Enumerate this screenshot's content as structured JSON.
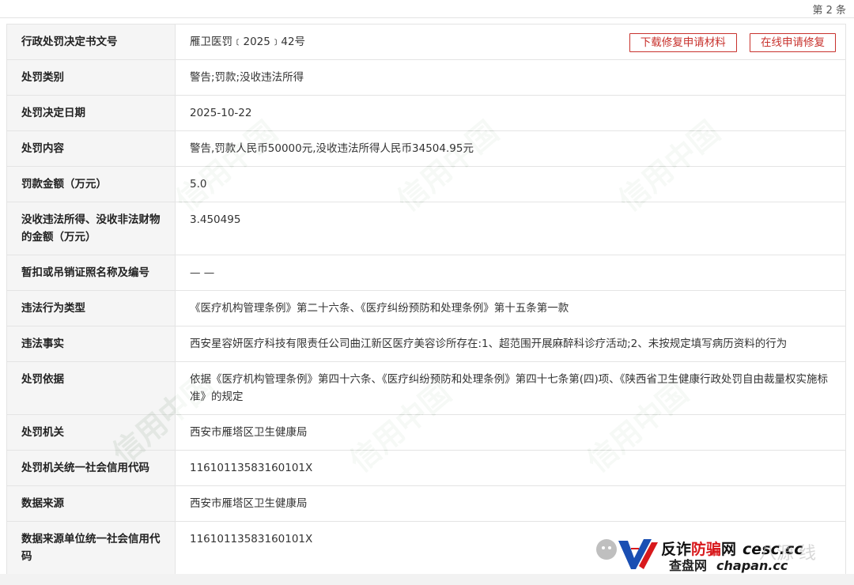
{
  "header": {
    "record_number": "第 2 条"
  },
  "actions": {
    "download_label": "下载修复申请材料",
    "online_label": "在线申请修复"
  },
  "rows": [
    {
      "key": "行政处罚决定书文号",
      "value": "雁卫医罚﹝2025﹞42号"
    },
    {
      "key": "处罚类别",
      "value": "警告;罚款;没收违法所得"
    },
    {
      "key": "处罚决定日期",
      "value": "2025-10-22"
    },
    {
      "key": "处罚内容",
      "value": "警告,罚款人民币50000元,没收违法所得人民币34504.95元"
    },
    {
      "key": "罚款金额（万元）",
      "value": "5.0"
    },
    {
      "key": "没收违法所得、没收非法财物的金额（万元）",
      "value": "3.450495"
    },
    {
      "key": "暂扣或吊销证照名称及编号",
      "value": "— —"
    },
    {
      "key": "违法行为类型",
      "value": "《医疗机构管理条例》第二十六条、《医疗纠纷预防和处理条例》第十五条第一款"
    },
    {
      "key": "违法事实",
      "value": "西安星容妍医疗科技有限责任公司曲江新区医疗美容诊所存在:1、超范围开展麻醉科诊疗活动;2、未按规定填写病历资料的行为"
    },
    {
      "key": "处罚依据",
      "value": "依据《医疗机构管理条例》第四十六条、《医疗纠纷预防和处理条例》第四十七条第(四)项、《陕西省卫生健康行政处罚自由裁量权实施标准》的规定"
    },
    {
      "key": "处罚机关",
      "value": "西安市雁塔区卫生健康局"
    },
    {
      "key": "处罚机关统一社会信用代码",
      "value": "11610113583160101X"
    },
    {
      "key": "数据来源",
      "value": "西安市雁塔区卫生健康局"
    },
    {
      "key": "数据来源单位统一社会信用代码",
      "value": "11610113583160101X"
    }
  ],
  "watermark": {
    "text": "信用中国"
  },
  "logo": {
    "line1_black": "反诈",
    "line1_red": "防骗",
    "line1_black2": "网",
    "line1_domain": "cesc.cc",
    "line2_text": "查盘网",
    "line2_domain": "chapan.cc",
    "ghost_text": "八源",
    "ghost_text2": "线",
    "brand_red": "#d8191c",
    "brand_blue": "#1a4fb3"
  },
  "colors": {
    "accent": "#c8322d",
    "label_bg": "#f5f5f5",
    "border": "#e4e4e4"
  }
}
